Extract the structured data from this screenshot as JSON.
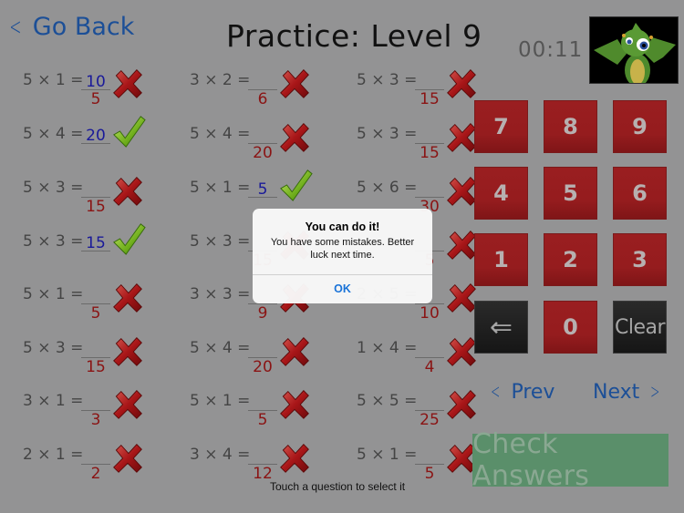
{
  "header": {
    "back_label": "Go Back",
    "title": "Practice: Level 9",
    "timer": "00:11",
    "mascot": "dragon-mascot"
  },
  "colors": {
    "background": "#939394",
    "link_blue": "#1c4f97",
    "key_red": "#951c1e",
    "key_dark": "#1a1a1a",
    "check_green": "#5a8f6a",
    "wrong_answer_red": "#8a1414",
    "given_answer_blue": "#1a1a99"
  },
  "questions": [
    {
      "eq": "5 × 1 =",
      "given": "10",
      "correct": "5",
      "status": "wrong"
    },
    {
      "eq": "3 × 2 =",
      "given": "",
      "correct": "6",
      "status": "wrong"
    },
    {
      "eq": "5 × 3 =",
      "given": "",
      "correct": "15",
      "status": "wrong"
    },
    {
      "eq": "5 × 4 =",
      "given": "20",
      "correct": "",
      "status": "right"
    },
    {
      "eq": "5 × 4 =",
      "given": "",
      "correct": "20",
      "status": "wrong"
    },
    {
      "eq": "5 × 3 =",
      "given": "",
      "correct": "15",
      "status": "wrong"
    },
    {
      "eq": "5 × 3 =",
      "given": "",
      "correct": "15",
      "status": "wrong"
    },
    {
      "eq": "5 × 1 =",
      "given": "5",
      "correct": "",
      "status": "right"
    },
    {
      "eq": "5 × 6 =",
      "given": "",
      "correct": "30",
      "status": "wrong"
    },
    {
      "eq": "5 × 3 =",
      "given": "15",
      "correct": "",
      "status": "right"
    },
    {
      "eq": "5 × 3 =",
      "given": "",
      "correct": "15",
      "status": "wrong"
    },
    {
      "eq": "",
      "given": "",
      "correct": "5",
      "status": "wrong"
    },
    {
      "eq": "5 × 1 =",
      "given": "",
      "correct": "5",
      "status": "wrong"
    },
    {
      "eq": "3 × 3 =",
      "given": "",
      "correct": "9",
      "status": "wrong"
    },
    {
      "eq": "2 × 5 =",
      "given": "",
      "correct": "10",
      "status": "wrong"
    },
    {
      "eq": "5 × 3 =",
      "given": "",
      "correct": "15",
      "status": "wrong"
    },
    {
      "eq": "5 × 4 =",
      "given": "",
      "correct": "20",
      "status": "wrong"
    },
    {
      "eq": "1 × 4 =",
      "given": "",
      "correct": "4",
      "status": "wrong"
    },
    {
      "eq": "3 × 1 =",
      "given": "",
      "correct": "3",
      "status": "wrong"
    },
    {
      "eq": "5 × 1 =",
      "given": "",
      "correct": "5",
      "status": "wrong"
    },
    {
      "eq": "5 × 5 =",
      "given": "",
      "correct": "25",
      "status": "wrong"
    },
    {
      "eq": "2 × 1 =",
      "given": "",
      "correct": "2",
      "status": "wrong"
    },
    {
      "eq": "3 × 4 =",
      "given": "",
      "correct": "12",
      "status": "wrong"
    },
    {
      "eq": "5 × 1 =",
      "given": "",
      "correct": "5",
      "status": "wrong"
    }
  ],
  "keypad": {
    "keys": [
      "7",
      "8",
      "9",
      "4",
      "5",
      "6",
      "1",
      "2",
      "3",
      "⇐",
      "0",
      "Clear"
    ]
  },
  "nav": {
    "prev_label": "Prev",
    "next_label": "Next"
  },
  "check_label": "Check Answers",
  "hint": "Touch a question to select it",
  "alert": {
    "title": "You can do it!",
    "message": "You have some mistakes. Better luck next time.",
    "ok_label": "OK"
  }
}
